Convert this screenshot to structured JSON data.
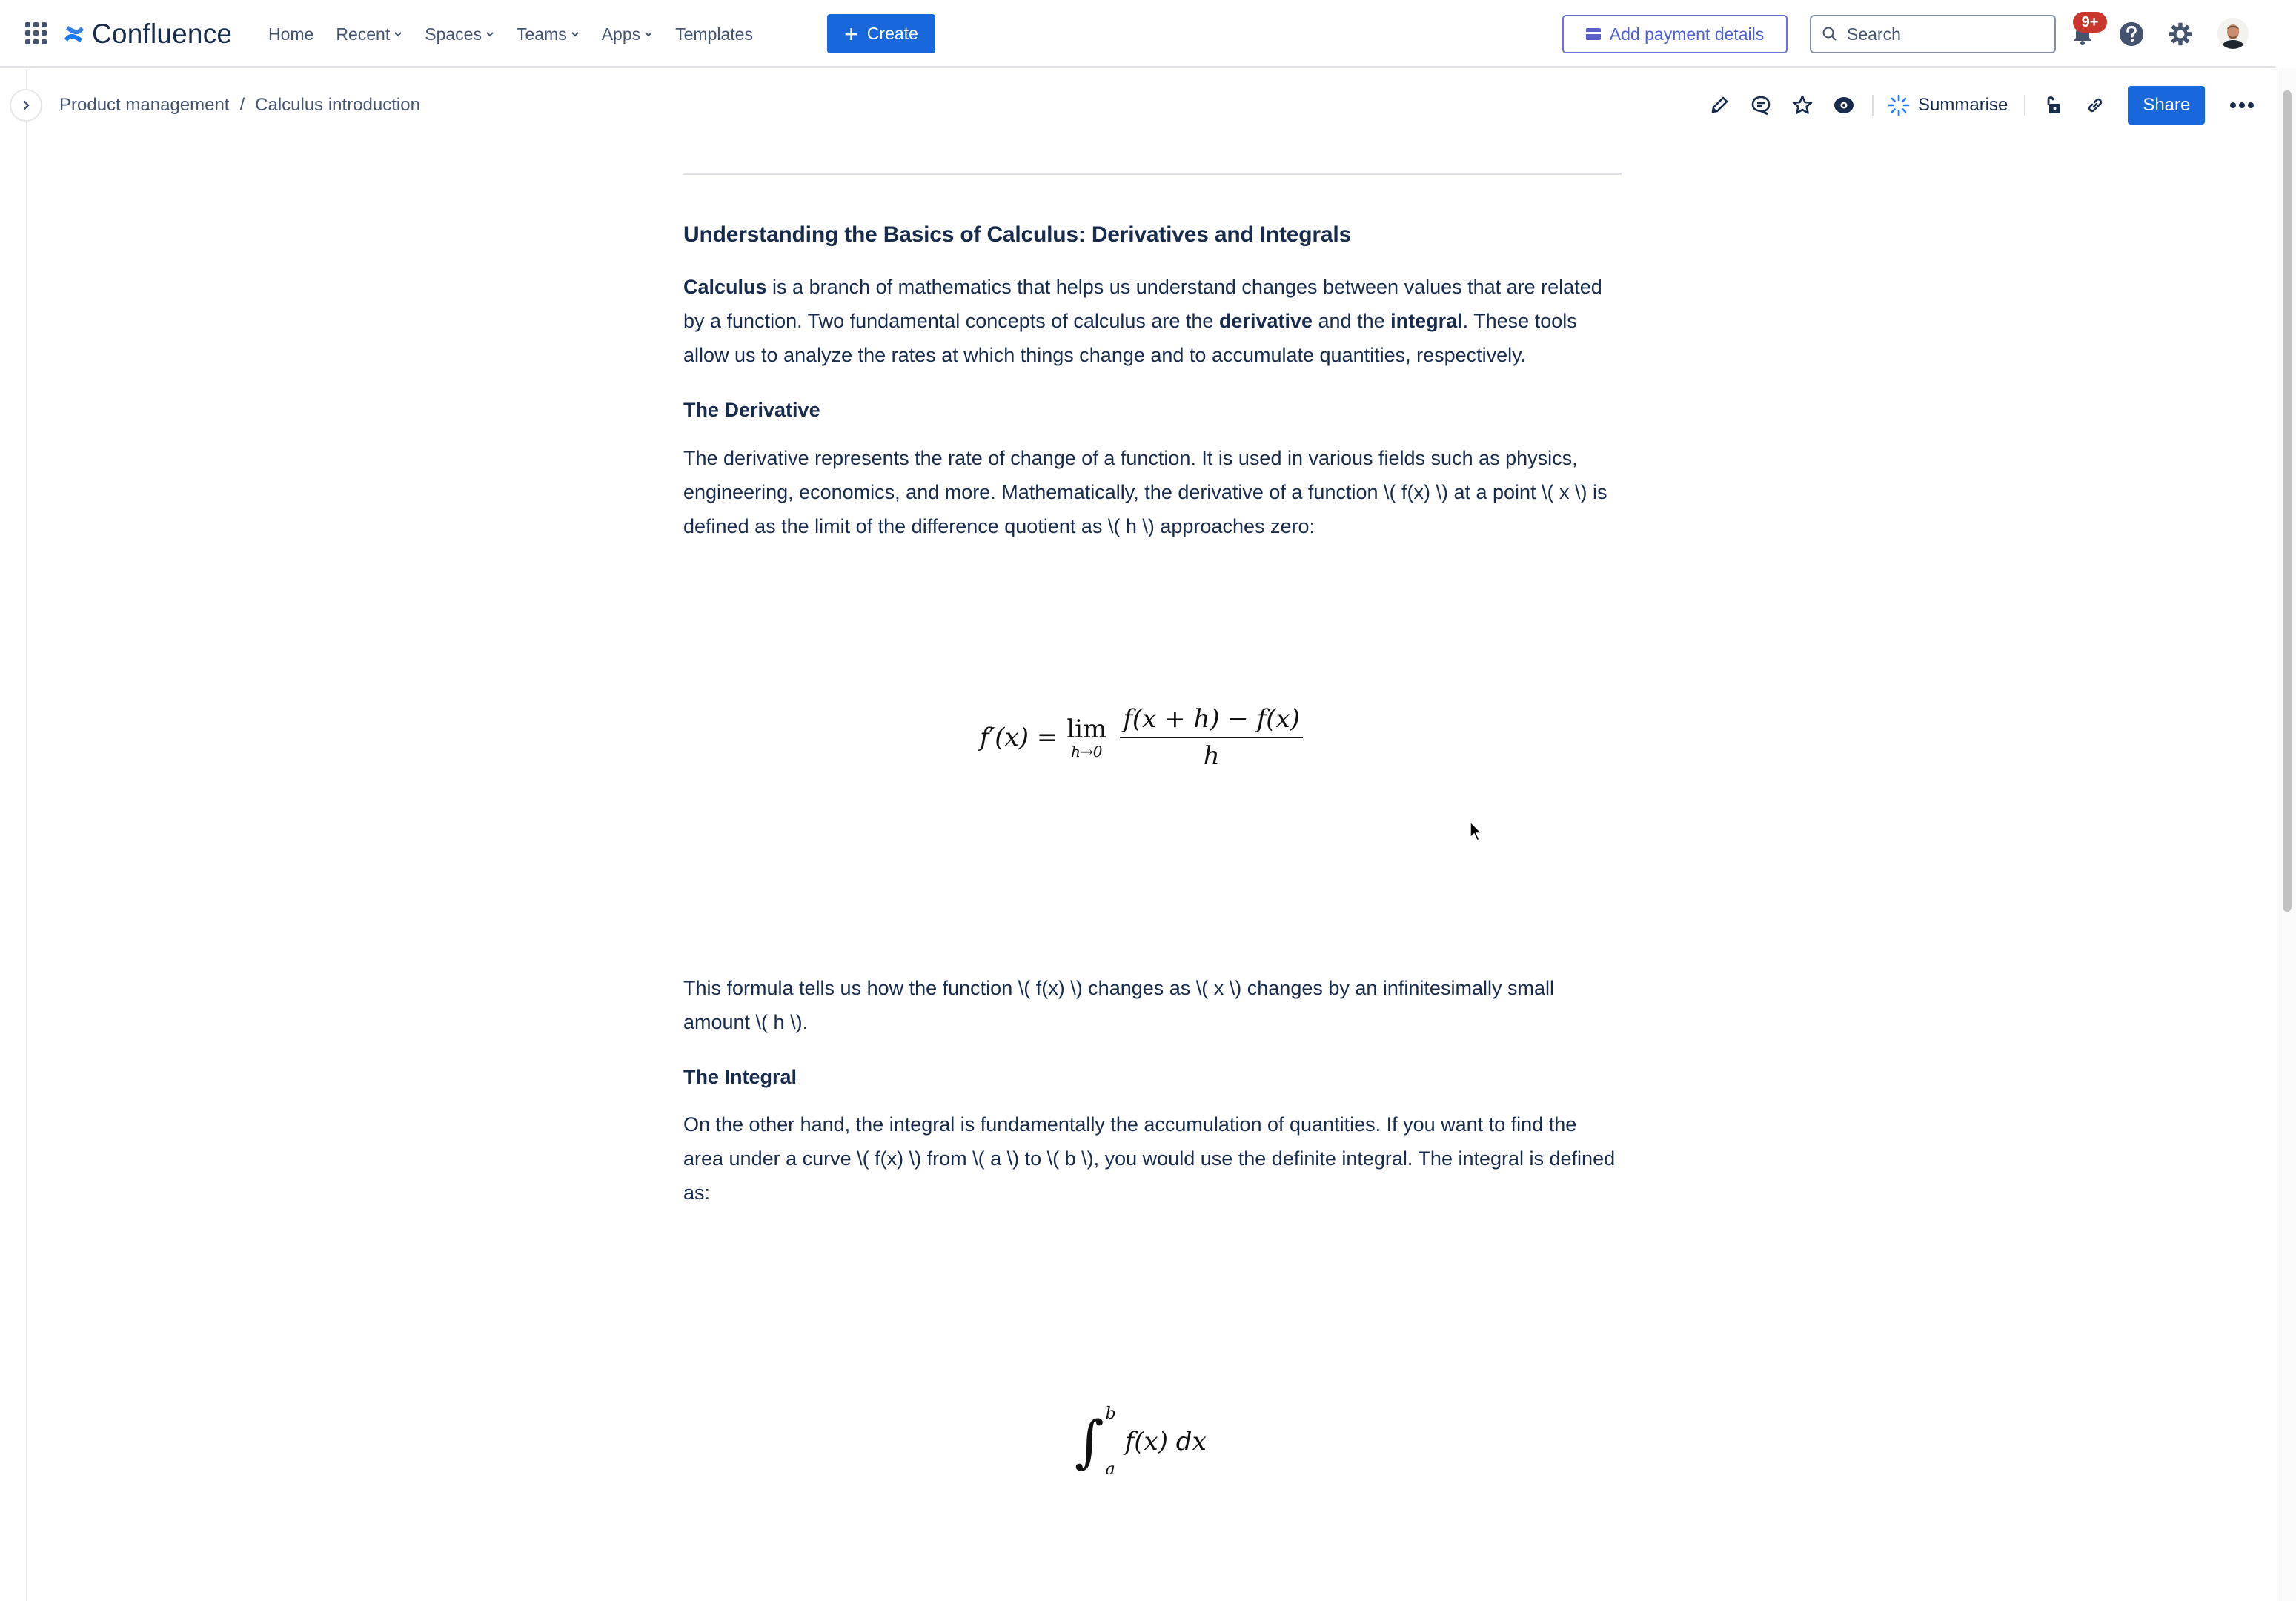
{
  "topnav": {
    "app_name": "Confluence",
    "items": [
      {
        "label": "Home",
        "has_dropdown": false
      },
      {
        "label": "Recent",
        "has_dropdown": true
      },
      {
        "label": "Spaces",
        "has_dropdown": true
      },
      {
        "label": "Teams",
        "has_dropdown": true
      },
      {
        "label": "Apps",
        "has_dropdown": true
      },
      {
        "label": "Templates",
        "has_dropdown": false
      }
    ],
    "create_label": "Create",
    "payment_label": "Add payment details",
    "search_placeholder": "Search",
    "notification_badge": "9+",
    "icons": [
      "app-switcher-icon",
      "confluence-logo-icon",
      "search-icon",
      "bell-icon",
      "help-icon",
      "gear-icon",
      "avatar"
    ]
  },
  "breadcrumb": {
    "items": [
      "Product management",
      "Calculus introduction"
    ],
    "separator": "/"
  },
  "page_tools": {
    "summarise_label": "Summarise",
    "share_label": "Share",
    "icons": [
      "edit-icon",
      "comment-icon",
      "star-icon",
      "watch-icon",
      "summarise-icon",
      "restrictions-unlock-icon",
      "copy-link-icon",
      "more-icon"
    ]
  },
  "article": {
    "title": "Understanding the Basics of Calculus: Derivatives and Integrals",
    "intro": {
      "b1": "Calculus",
      "t1": " is a branch of mathematics that helps us understand changes between values that are related by a function. Two fundamental concepts of calculus are the ",
      "b2": "derivative",
      "t2": " and the ",
      "b3": "integral",
      "t3": ". These tools allow us to analyze the rates at which things change and to accumulate quantities, respectively."
    },
    "derivative_heading": "The Derivative",
    "derivative_para": "The derivative represents the rate of change of a function. It is used in various fields such as physics, engineering, economics, and more. Mathematically, the derivative of a function \\( f(x) \\) at a point \\( x \\) is defined as the limit of the difference quotient as \\( h \\) approaches zero:",
    "derivative_formula": {
      "lhs": "f′(x) =",
      "lim": "lim",
      "lim_sub": "h→0",
      "numerator": "f(x + h) − f(x)",
      "denominator": "h"
    },
    "formula_explain": "This formula tells us how the function \\( f(x) \\) changes as \\( x \\) changes by an infinitesimally small amount \\( h \\).",
    "integral_heading": "The Integral",
    "integral_para": "On the other hand, the integral is fundamentally the accumulation of quantities. If you want to find the area under a curve \\( f(x) \\) from \\( a \\) to \\( b \\), you would use the definite integral. The integral is defined as:",
    "integral_formula": {
      "symbol": "∫",
      "upper": "b",
      "lower": "a",
      "integrand": "f(x) dx"
    }
  },
  "colors": {
    "brand_blue": "#1868db",
    "text_primary": "#172b4d",
    "text_subtle": "#44546f",
    "badge_red": "#c9372c",
    "payment_purple": "#5b5fc7"
  }
}
